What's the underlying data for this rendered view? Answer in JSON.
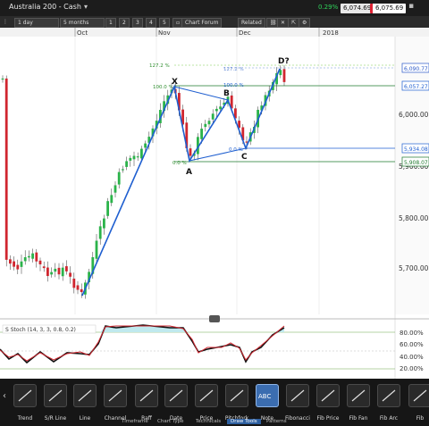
{
  "title_bar": {
    "title": "Australia 200 - Cash",
    "change_pct": "0.29%",
    "sell_price": "6,074.69",
    "buy_price": "6,075.69"
  },
  "toolbar": {
    "interval": "1 day",
    "range": "5 months",
    "chart_forum": "Chart Forum",
    "related": "Related"
  },
  "x_axis_labels": [
    "Oct",
    "Nov",
    "Dec",
    "2018"
  ],
  "price_axis_labels": [
    "6,000.00",
    "5,900.00",
    "5,800.00",
    "5,700.00"
  ],
  "price_tags": [
    "6,090.77",
    "6,057.27",
    "5,934.08",
    "5,908.07"
  ],
  "pattern": {
    "points": [
      "X",
      "A",
      "B",
      "C",
      "D?"
    ],
    "fib_labels": [
      "127.2 %",
      "100.0 %",
      "0.0 %",
      "127.2 %",
      "100.0 %",
      "0.0 %"
    ]
  },
  "stoch": {
    "label": "S Stoch (14, 3, 3, 0.8, 0.2)",
    "axis_labels": [
      "80.00%",
      "60.00%",
      "40.00%",
      "20.00%"
    ]
  },
  "draw_tools": [
    {
      "label": "Trend",
      "icon": "trend-line-icon"
    },
    {
      "label": "S/R Line",
      "icon": "sr-line-icon"
    },
    {
      "label": "Line",
      "icon": "line-icon"
    },
    {
      "label": "Channel",
      "icon": "channel-icon"
    },
    {
      "label": "Raff",
      "icon": "raff-icon"
    },
    {
      "label": "Date",
      "icon": "date-icon"
    },
    {
      "label": "Price",
      "icon": "price-icon"
    },
    {
      "label": "Pitchfork",
      "icon": "pitchfork-icon"
    },
    {
      "label": "Note",
      "icon": "note-icon"
    },
    {
      "label": "Fibonacci",
      "icon": "fibonacci-icon"
    },
    {
      "label": "Fib Price",
      "icon": "fib-price-icon"
    },
    {
      "label": "Fib Fan",
      "icon": "fib-fan-icon"
    },
    {
      "label": "Fib Arc",
      "icon": "fib-arc-icon"
    },
    {
      "label": "Fib",
      "icon": "fib-icon"
    }
  ],
  "note_icon_text": "ABC",
  "sub_tabs": [
    "Timeframe",
    "Chart Type",
    "Technicals",
    "Draw Tools",
    "Patterns"
  ],
  "colors": {
    "pattern_line": "#1f5fd0",
    "candle_up": "#2bb34a",
    "candle_down": "#d0262f",
    "stoch_fill": "#bfe9ee",
    "stoch_k": "#d0262f",
    "stoch_d": "#111111",
    "selected_tool": "#3b6db0"
  }
}
